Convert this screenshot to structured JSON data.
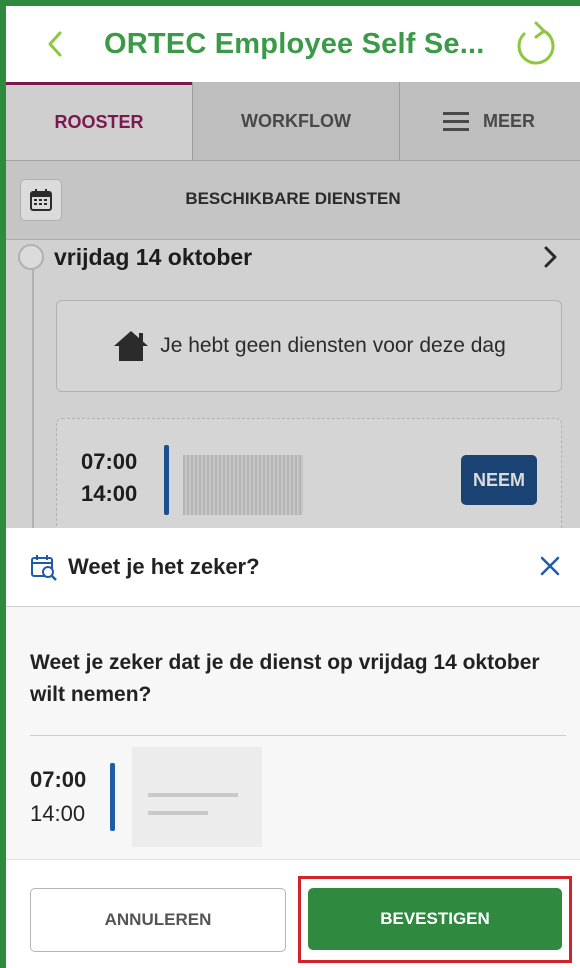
{
  "app": {
    "title": "ORTEC Employee Self Se...",
    "back_icon": "chevron-left-icon",
    "refresh_icon": "refresh-icon"
  },
  "tabs": [
    {
      "label": "ROOSTER",
      "active": true
    },
    {
      "label": "WORKFLOW",
      "active": false
    },
    {
      "label": "MEER",
      "active": false,
      "icon": "hamburger-menu-icon"
    }
  ],
  "subbar": {
    "calendar_icon": "calendar-icon",
    "title": "BESCHIKBARE DIENSTEN"
  },
  "schedule": {
    "day_label": "vrijdag 14 oktober",
    "empty_message": "Je hebt geen diensten voor deze dag",
    "shift": {
      "start": "07:00",
      "end": "14:00",
      "action_label": "NEEM"
    }
  },
  "dialog": {
    "title": "Weet je het zeker?",
    "question": "Weet je zeker dat je de dienst op vrijdag 14 oktober wilt nemen?",
    "shift": {
      "start": "07:00",
      "end": "14:00"
    },
    "cancel_label": "ANNULEREN",
    "confirm_label": "BEVESTIGEN"
  },
  "colors": {
    "brand_green": "#3a9a48",
    "active_tab": "#8e1c5e",
    "shift_bar": "#1f5ca8",
    "neem_button": "#1f4f87",
    "confirm_button": "#2f8a3f",
    "highlight_outline": "#d2232a"
  }
}
